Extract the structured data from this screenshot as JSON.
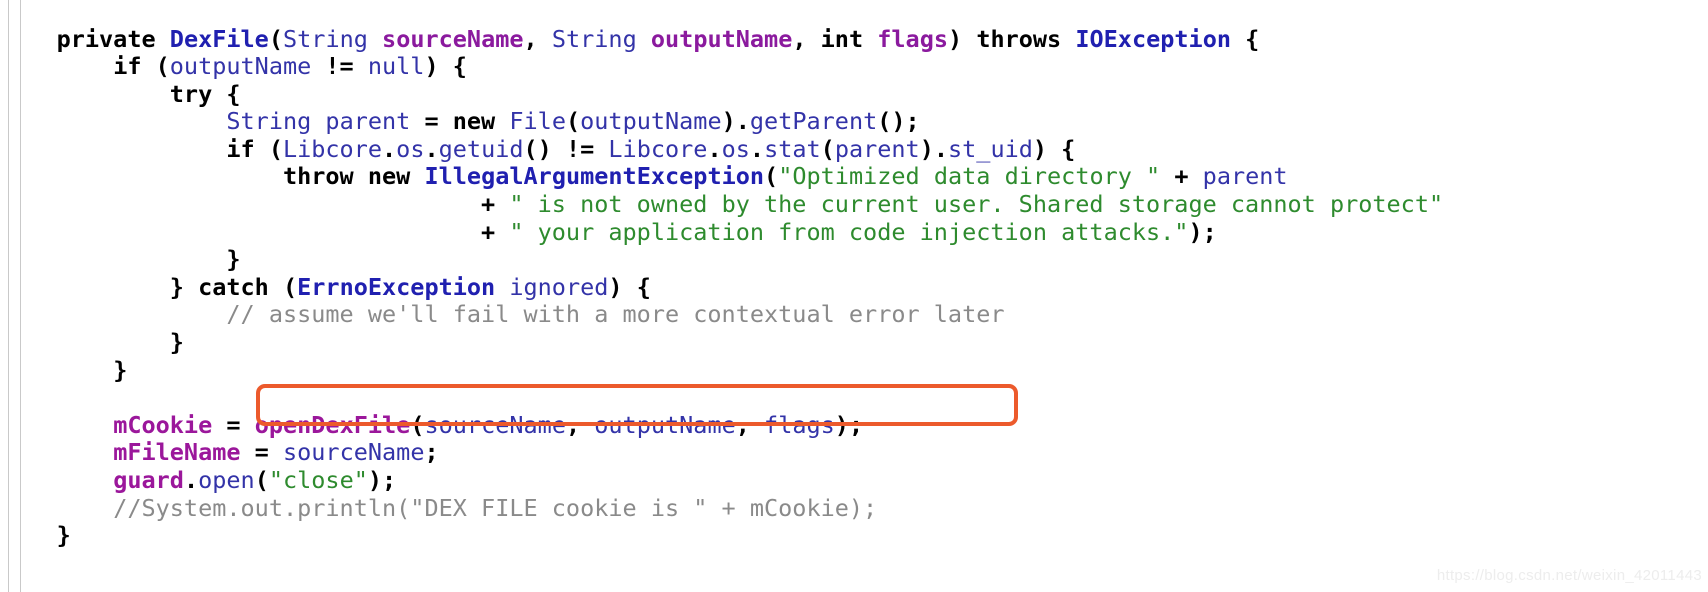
{
  "viewer": {
    "name": "java-source-code-snippet",
    "language": "Java",
    "background": "#ffffff"
  },
  "highlight": {
    "color": "#ec5a2c",
    "target_text": "openDexFile(sourceName, outputName, flags);",
    "shape": "rounded-rectangle",
    "border_width_px": 4
  },
  "colors": {
    "keyword": "#000000",
    "type": "#2020b0",
    "identifier": "#3333a8",
    "parameter": "#8b1a9e",
    "field": "#9b179b",
    "string": "#2e8b2e",
    "comment": "#8a8a8a",
    "highlight": "#ec5a2c",
    "watermark": "#ededed"
  },
  "watermark": {
    "text": "https://blog.csdn.net/weixin_42011443"
  },
  "code": {
    "full_text": "    private DexFile(String sourceName, String outputName, int flags) throws IOException {\n        if (outputName != null) {\n            try {\n                String parent = new File(outputName).getParent();\n                if (Libcore.os.getuid() != Libcore.os.stat(parent).st_uid) {\n                    throw new IllegalArgumentException(\"Optimized data directory \" + parent\n                            + \" is not owned by the current user. Shared storage cannot protect\"\n                            + \" your application from code injection attacks.\");\n                }\n            } catch (ErrnoException ignored) {\n                // assume we'll fail with a more contextual error later\n            }\n        }\n\n        mCookie = openDexFile(sourceName, outputName, flags);\n        mFileName = sourceName;\n        guard.open(\"close\");\n        //System.out.println(\"DEX FILE cookie is \" + mCookie);\n    }",
    "lines": [
      {
        "id": "line-1",
        "indent": 2,
        "tokens": [
          {
            "text": "private",
            "kind": "keyword"
          },
          {
            "text": " ",
            "kind": "plain"
          },
          {
            "text": "DexFile",
            "kind": "type"
          },
          {
            "text": "(",
            "kind": "plain"
          },
          {
            "text": "String",
            "kind": "identifier"
          },
          {
            "text": " ",
            "kind": "plain"
          },
          {
            "text": "sourceName",
            "kind": "parameter"
          },
          {
            "text": ", ",
            "kind": "plain"
          },
          {
            "text": "String",
            "kind": "identifier"
          },
          {
            "text": " ",
            "kind": "plain"
          },
          {
            "text": "outputName",
            "kind": "parameter"
          },
          {
            "text": ", ",
            "kind": "plain"
          },
          {
            "text": "int",
            "kind": "keyword"
          },
          {
            "text": " ",
            "kind": "plain"
          },
          {
            "text": "flags",
            "kind": "parameter"
          },
          {
            "text": ") ",
            "kind": "plain"
          },
          {
            "text": "throws",
            "kind": "keyword"
          },
          {
            "text": " ",
            "kind": "plain"
          },
          {
            "text": "IOException",
            "kind": "type"
          },
          {
            "text": " {",
            "kind": "plain"
          }
        ]
      },
      {
        "id": "line-2",
        "indent": 4,
        "tokens": [
          {
            "text": "if",
            "kind": "keyword"
          },
          {
            "text": " (",
            "kind": "plain"
          },
          {
            "text": "outputName",
            "kind": "identifier"
          },
          {
            "text": " != ",
            "kind": "plain"
          },
          {
            "text": "null",
            "kind": "identifier"
          },
          {
            "text": ") {",
            "kind": "plain"
          }
        ]
      },
      {
        "id": "line-3",
        "indent": 6,
        "tokens": [
          {
            "text": "try",
            "kind": "keyword"
          },
          {
            "text": " {",
            "kind": "plain"
          }
        ]
      },
      {
        "id": "line-4",
        "indent": 8,
        "tokens": [
          {
            "text": "String",
            "kind": "identifier"
          },
          {
            "text": " ",
            "kind": "plain"
          },
          {
            "text": "parent",
            "kind": "identifier"
          },
          {
            "text": " = ",
            "kind": "plain"
          },
          {
            "text": "new",
            "kind": "keyword"
          },
          {
            "text": " ",
            "kind": "plain"
          },
          {
            "text": "File",
            "kind": "identifier"
          },
          {
            "text": "(",
            "kind": "plain"
          },
          {
            "text": "outputName",
            "kind": "identifier"
          },
          {
            "text": ").",
            "kind": "plain"
          },
          {
            "text": "getParent",
            "kind": "identifier"
          },
          {
            "text": "();",
            "kind": "plain"
          }
        ]
      },
      {
        "id": "line-5",
        "indent": 8,
        "tokens": [
          {
            "text": "if",
            "kind": "keyword"
          },
          {
            "text": " (",
            "kind": "plain"
          },
          {
            "text": "Libcore",
            "kind": "identifier"
          },
          {
            "text": ".",
            "kind": "plain"
          },
          {
            "text": "os",
            "kind": "identifier"
          },
          {
            "text": ".",
            "kind": "plain"
          },
          {
            "text": "getuid",
            "kind": "identifier"
          },
          {
            "text": "() != ",
            "kind": "plain"
          },
          {
            "text": "Libcore",
            "kind": "identifier"
          },
          {
            "text": ".",
            "kind": "plain"
          },
          {
            "text": "os",
            "kind": "identifier"
          },
          {
            "text": ".",
            "kind": "plain"
          },
          {
            "text": "stat",
            "kind": "identifier"
          },
          {
            "text": "(",
            "kind": "plain"
          },
          {
            "text": "parent",
            "kind": "identifier"
          },
          {
            "text": ").",
            "kind": "plain"
          },
          {
            "text": "st_uid",
            "kind": "identifier"
          },
          {
            "text": ") {",
            "kind": "plain"
          }
        ]
      },
      {
        "id": "line-6",
        "indent": 10,
        "tokens": [
          {
            "text": "throw",
            "kind": "keyword"
          },
          {
            "text": " ",
            "kind": "plain"
          },
          {
            "text": "new",
            "kind": "keyword"
          },
          {
            "text": " ",
            "kind": "plain"
          },
          {
            "text": "IllegalArgumentException",
            "kind": "type"
          },
          {
            "text": "(",
            "kind": "plain"
          },
          {
            "text": "\"Optimized data directory \"",
            "kind": "string"
          },
          {
            "text": " + ",
            "kind": "plain"
          },
          {
            "text": "parent",
            "kind": "identifier"
          }
        ]
      },
      {
        "id": "line-7",
        "indent": 17,
        "tokens": [
          {
            "text": "+ ",
            "kind": "plain"
          },
          {
            "text": "\" is not owned by the current user. Shared storage cannot protect\"",
            "kind": "string"
          }
        ]
      },
      {
        "id": "line-8",
        "indent": 17,
        "tokens": [
          {
            "text": "+ ",
            "kind": "plain"
          },
          {
            "text": "\" your application from code injection attacks.\"",
            "kind": "string"
          },
          {
            "text": ");",
            "kind": "plain"
          }
        ]
      },
      {
        "id": "line-9",
        "indent": 8,
        "tokens": [
          {
            "text": "}",
            "kind": "plain"
          }
        ]
      },
      {
        "id": "line-10",
        "indent": 6,
        "tokens": [
          {
            "text": "} ",
            "kind": "plain"
          },
          {
            "text": "catch",
            "kind": "keyword"
          },
          {
            "text": " (",
            "kind": "plain"
          },
          {
            "text": "ErrnoException",
            "kind": "type"
          },
          {
            "text": " ",
            "kind": "plain"
          },
          {
            "text": "ignored",
            "kind": "identifier"
          },
          {
            "text": ") {",
            "kind": "plain"
          }
        ]
      },
      {
        "id": "line-11",
        "indent": 8,
        "tokens": [
          {
            "text": "// assume we'll fail with a more contextual error later",
            "kind": "comment"
          }
        ]
      },
      {
        "id": "line-12",
        "indent": 6,
        "tokens": [
          {
            "text": "}",
            "kind": "plain"
          }
        ]
      },
      {
        "id": "line-13",
        "indent": 4,
        "tokens": [
          {
            "text": "}",
            "kind": "plain"
          }
        ]
      },
      {
        "id": "line-14",
        "indent": 0,
        "tokens": []
      },
      {
        "id": "line-15",
        "indent": 4,
        "tokens": [
          {
            "text": "mCookie",
            "kind": "field"
          },
          {
            "text": " = ",
            "kind": "plain"
          },
          {
            "text": "openDexFile",
            "kind": "field"
          },
          {
            "text": "(",
            "kind": "plain"
          },
          {
            "text": "sourceName",
            "kind": "identifier"
          },
          {
            "text": ", ",
            "kind": "plain"
          },
          {
            "text": "outputName",
            "kind": "identifier"
          },
          {
            "text": ", ",
            "kind": "plain"
          },
          {
            "text": "flags",
            "kind": "identifier"
          },
          {
            "text": ");",
            "kind": "plain"
          }
        ]
      },
      {
        "id": "line-16",
        "indent": 4,
        "tokens": [
          {
            "text": "mFileName",
            "kind": "field"
          },
          {
            "text": " = ",
            "kind": "plain"
          },
          {
            "text": "sourceName",
            "kind": "identifier"
          },
          {
            "text": ";",
            "kind": "plain"
          }
        ]
      },
      {
        "id": "line-17",
        "indent": 4,
        "tokens": [
          {
            "text": "guard",
            "kind": "field"
          },
          {
            "text": ".",
            "kind": "plain"
          },
          {
            "text": "open",
            "kind": "identifier"
          },
          {
            "text": "(",
            "kind": "plain"
          },
          {
            "text": "\"close\"",
            "kind": "string"
          },
          {
            "text": ");",
            "kind": "plain"
          }
        ]
      },
      {
        "id": "line-18",
        "indent": 4,
        "tokens": [
          {
            "text": "//System.out.println(\"DEX FILE cookie is \" + mCookie);",
            "kind": "comment"
          }
        ]
      },
      {
        "id": "line-19",
        "indent": 2,
        "tokens": [
          {
            "text": "}",
            "kind": "plain"
          }
        ]
      }
    ]
  }
}
